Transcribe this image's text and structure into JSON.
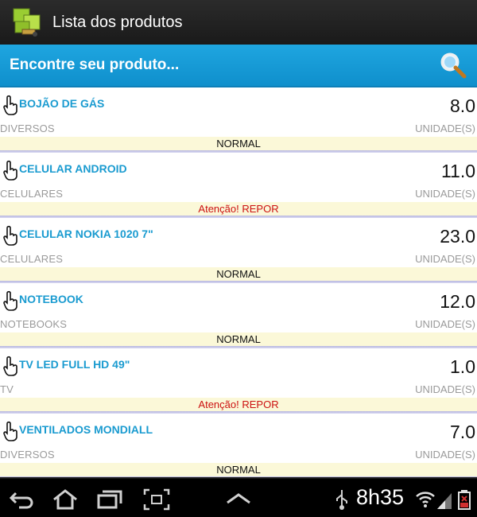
{
  "app": {
    "title": "Lista dos produtos",
    "icon": "inventory-boxes-icon"
  },
  "search": {
    "label": "Encontre seu produto...",
    "icon": "magnifier-icon"
  },
  "colors": {
    "title_bar": "#1e1e1e",
    "search_bar": "#18a0dc",
    "product_name": "#1a9bd0",
    "status_bg": "#fbf8d8",
    "warn": "#cc1111"
  },
  "products": [
    {
      "name": "BOJÃO DE GÁS",
      "qty": "8.0",
      "category": "DIVERSOS",
      "unit": "UNIDADE(S)",
      "status": "NORMAL",
      "warn": false
    },
    {
      "name": "CELULAR ANDROID",
      "qty": "11.0",
      "category": "CELULARES",
      "unit": "UNIDADE(S)",
      "status": "Atenção! REPOR",
      "warn": true
    },
    {
      "name": "CELULAR NOKIA 1020 7\"",
      "qty": "23.0",
      "category": "CELULARES",
      "unit": "UNIDADE(S)",
      "status": "NORMAL",
      "warn": false
    },
    {
      "name": "NOTEBOOK",
      "qty": "12.0",
      "category": "NOTEBOOKS",
      "unit": "UNIDADE(S)",
      "status": "NORMAL",
      "warn": false
    },
    {
      "name": "TV LED FULL HD 49\"",
      "qty": "1.0",
      "category": "TV",
      "unit": "UNIDADE(S)",
      "status": "Atenção! REPOR",
      "warn": true
    },
    {
      "name": "VENTILADOS MONDIALL",
      "qty": "7.0",
      "category": "DIVERSOS",
      "unit": "UNIDADE(S)",
      "status": "NORMAL",
      "warn": false
    }
  ],
  "system_bar": {
    "clock": "8h35",
    "icons": [
      "back-icon",
      "home-icon",
      "recent-apps-icon",
      "screenshot-icon",
      "up-chevron-icon",
      "usb-icon",
      "wifi-icon",
      "signal-icon",
      "battery-icon"
    ]
  }
}
